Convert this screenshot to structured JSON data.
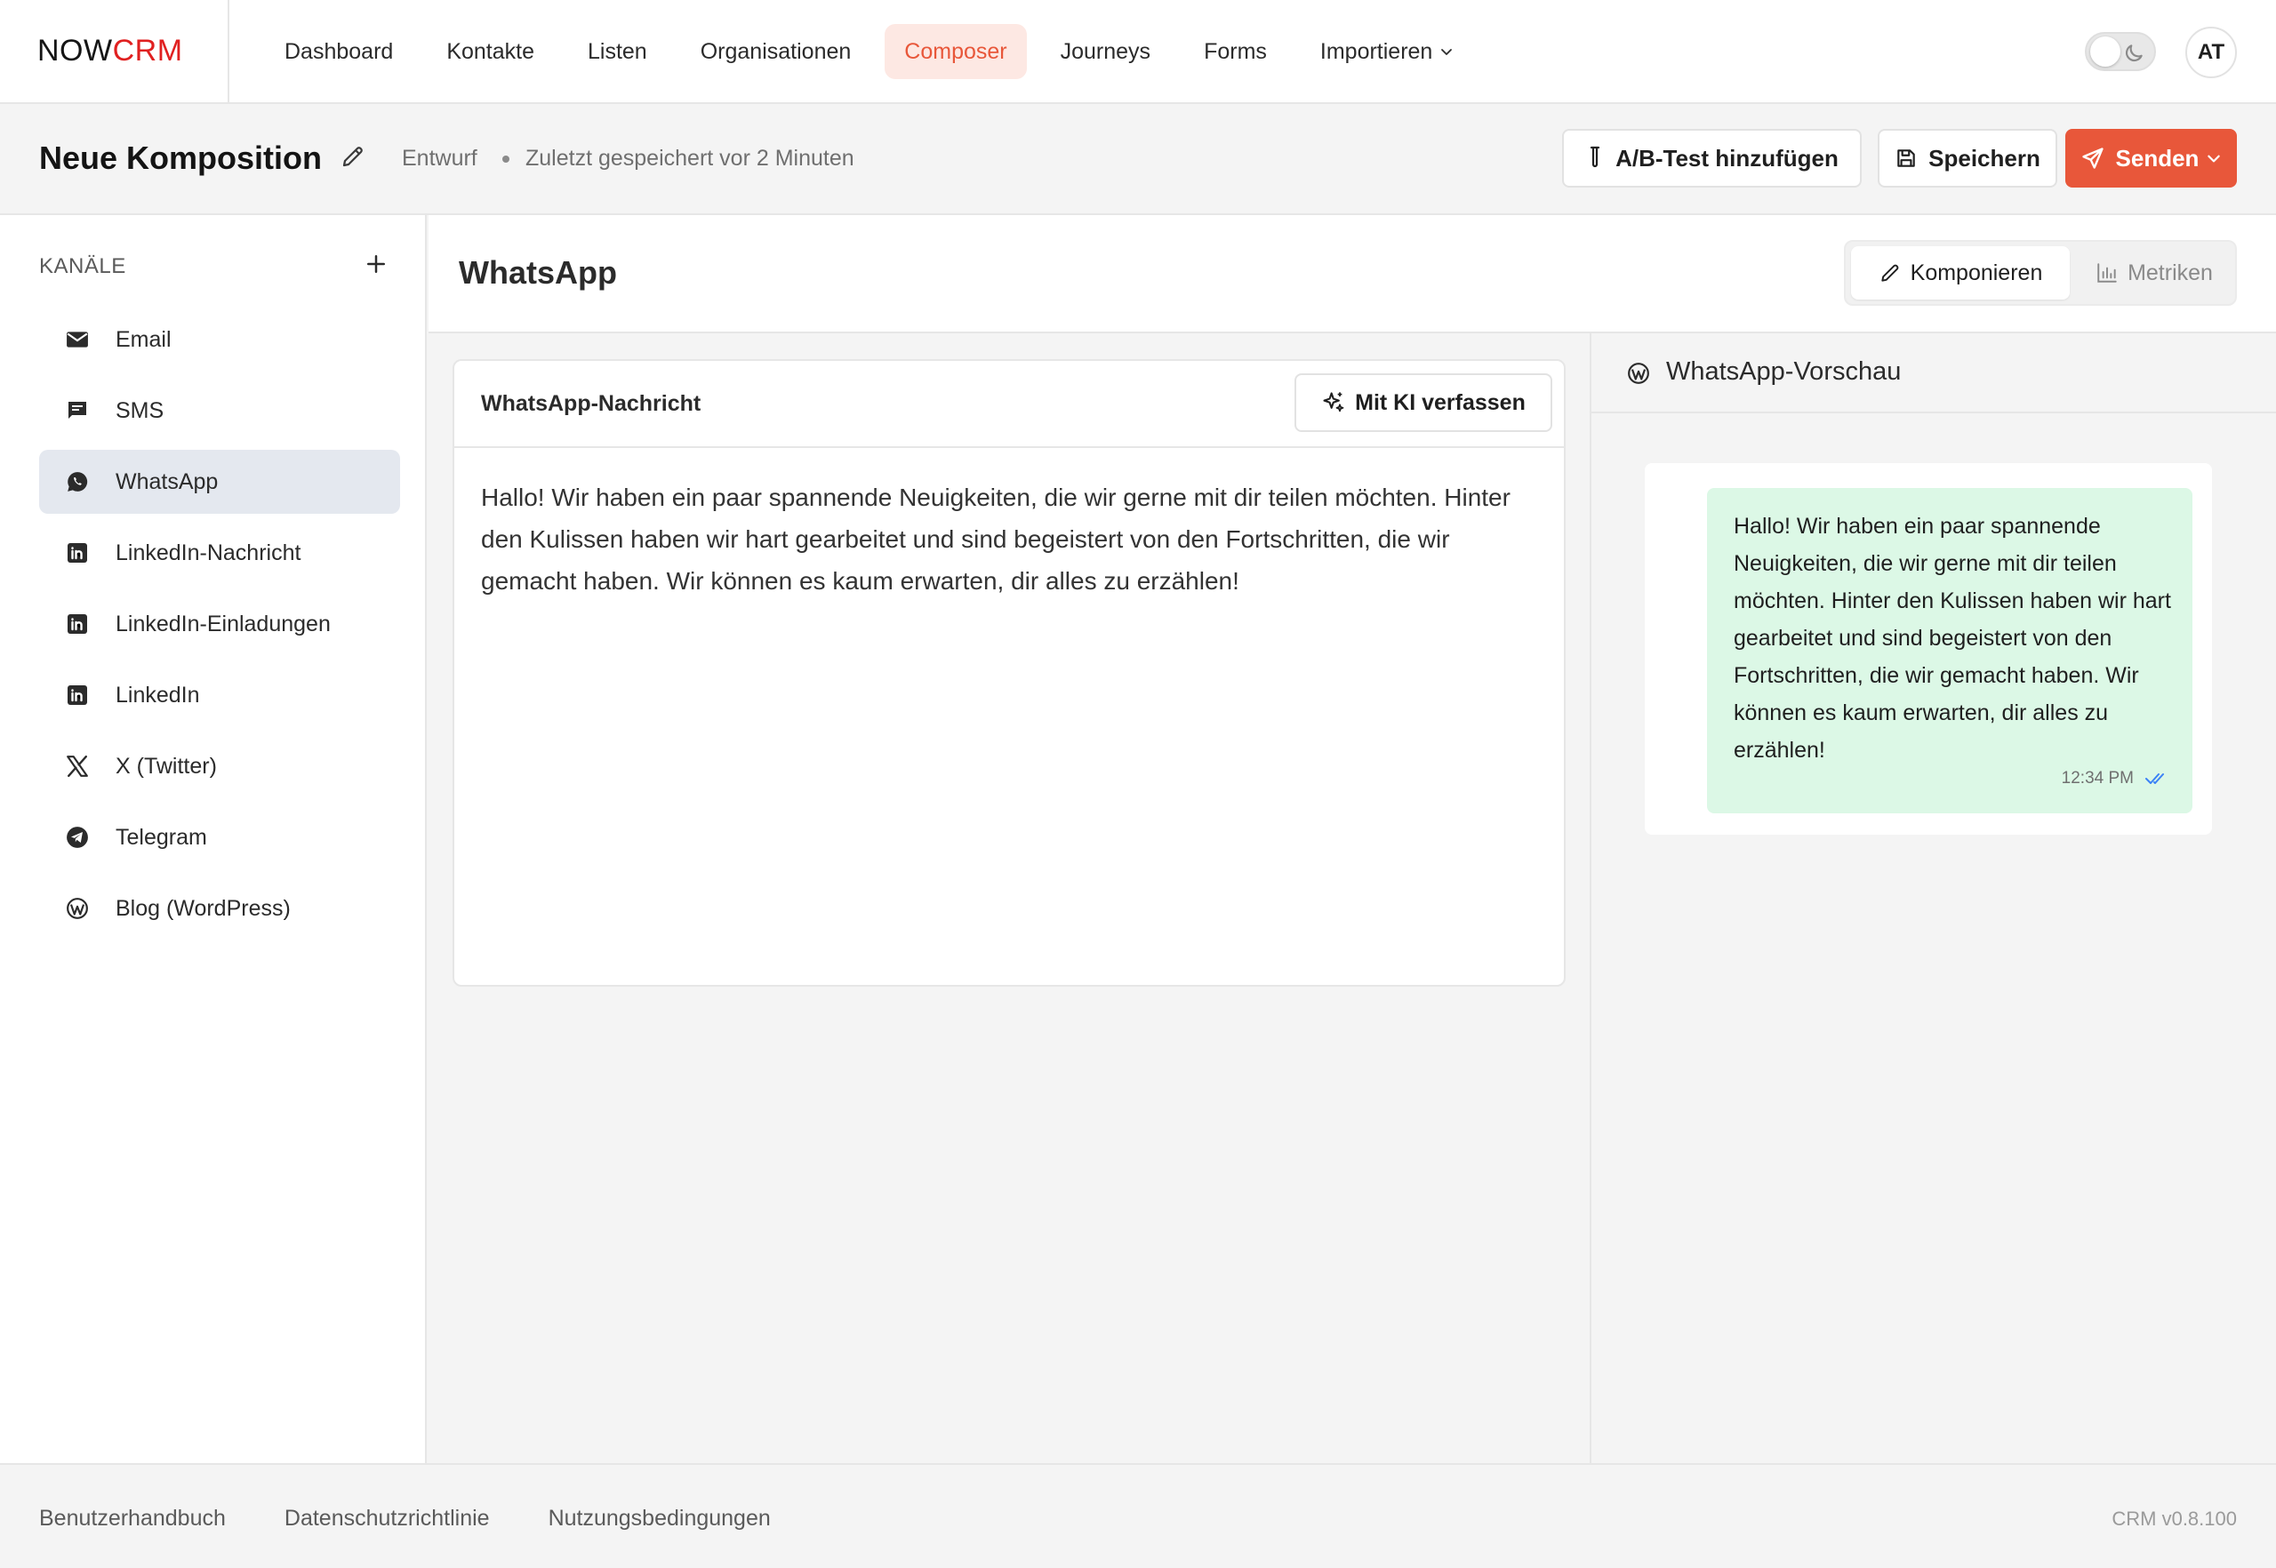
{
  "brand": {
    "part1": "NOW",
    "part2": "CRM",
    "color_accent": "#e02020"
  },
  "nav": {
    "items": [
      {
        "label": "Dashboard"
      },
      {
        "label": "Kontakte"
      },
      {
        "label": "Listen"
      },
      {
        "label": "Organisationen"
      },
      {
        "label": "Composer",
        "active": true
      },
      {
        "label": "Journeys"
      },
      {
        "label": "Forms"
      },
      {
        "label": "Importieren",
        "has_dropdown": true
      }
    ],
    "avatar_initials": "AT",
    "theme_toggle_icon": "moon-icon"
  },
  "header": {
    "title": "Neue Komposition",
    "status": "Entwurf",
    "saved": "Zuletzt gespeichert vor 2 Minuten",
    "ab_test_label": "A/B-Test hinzufügen",
    "save_label": "Speichern",
    "send_label": "Senden",
    "send_color": "#e8573a"
  },
  "sidebar": {
    "title": "KANÄLE",
    "items": [
      {
        "label": "Email",
        "icon": "mail-icon"
      },
      {
        "label": "SMS",
        "icon": "message-icon"
      },
      {
        "label": "WhatsApp",
        "icon": "whatsapp-icon",
        "active": true
      },
      {
        "label": "LinkedIn-Nachricht",
        "icon": "linkedin-icon"
      },
      {
        "label": "LinkedIn-Einladungen",
        "icon": "linkedin-icon"
      },
      {
        "label": "LinkedIn",
        "icon": "linkedin-icon"
      },
      {
        "label": "X (Twitter)",
        "icon": "x-icon"
      },
      {
        "label": "Telegram",
        "icon": "telegram-icon"
      },
      {
        "label": "Blog (WordPress)",
        "icon": "wordpress-icon"
      }
    ]
  },
  "main": {
    "title": "WhatsApp",
    "tabs": {
      "compose": "Komponieren",
      "metrics": "Metriken"
    },
    "editor": {
      "title": "WhatsApp-Nachricht",
      "ai_button": "Mit KI verfassen",
      "body": "Hallo! Wir haben ein paar spannende Neuigkeiten, die wir gerne mit dir teilen möchten. Hinter den Kulissen haben wir hart gearbeitet und sind begeistert von den Fortschritten, die wir gemacht haben. Wir können es kaum erwarten, dir alles zu erzählen!"
    },
    "preview": {
      "title": "WhatsApp-Vorschau",
      "message": "Hallo! Wir haben ein paar spannende Neuigkeiten, die wir gerne mit dir teilen möchten. Hinter den Kulissen haben wir hart gearbeitet und sind begeistert von den Fortschritten, die wir gemacht haben. Wir können es kaum erwarten, dir alles zu erzählen!",
      "time": "12:34 PM",
      "bubble_color": "#dcf8e6",
      "check_color": "#3b82f6"
    }
  },
  "footer": {
    "links": [
      "Benutzerhandbuch",
      "Datenschutzrichtlinie",
      "Nutzungsbedingungen"
    ],
    "version": "CRM v0.8.100"
  }
}
